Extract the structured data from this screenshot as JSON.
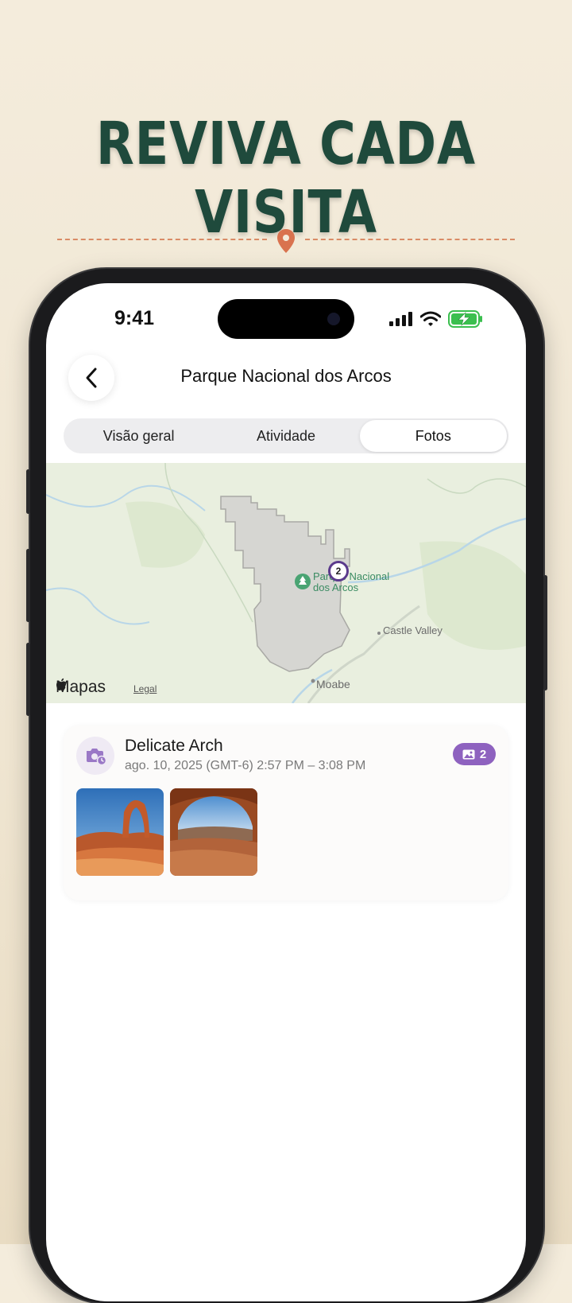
{
  "headline": "REVIVA CADA VISITA",
  "colors": {
    "headline": "#1f4a3c",
    "accent": "#d9734f",
    "badge": "#8e62bf",
    "cluster_ring": "#5b3a8c"
  },
  "status_bar": {
    "time": "9:41",
    "icons": [
      "signal-icon",
      "wifi-icon",
      "battery-charging-icon"
    ]
  },
  "nav": {
    "back_icon": "chevron-left-icon",
    "title": "Parque Nacional dos Arcos"
  },
  "tabs": [
    {
      "label": "Visão geral",
      "active": false
    },
    {
      "label": "Atividade",
      "active": false
    },
    {
      "label": "Fotos",
      "active": true
    }
  ],
  "map": {
    "park_label_line1": "Parque Nacional",
    "park_label_line2": "dos Arcos",
    "castle_valley": "Castle Valley",
    "moab": "Moabe",
    "attribution": "Mapas",
    "legal": "Legal",
    "cluster_count": "2"
  },
  "visit": {
    "title": "Delicate Arch",
    "subtitle": "ago. 10, 2025 (GMT-6) 2:57 PM – 3:08 PM",
    "photo_count": "2",
    "icon": "camera-clock-icon",
    "photos": [
      "delicate-arch-photo",
      "mesa-arch-photo"
    ]
  }
}
